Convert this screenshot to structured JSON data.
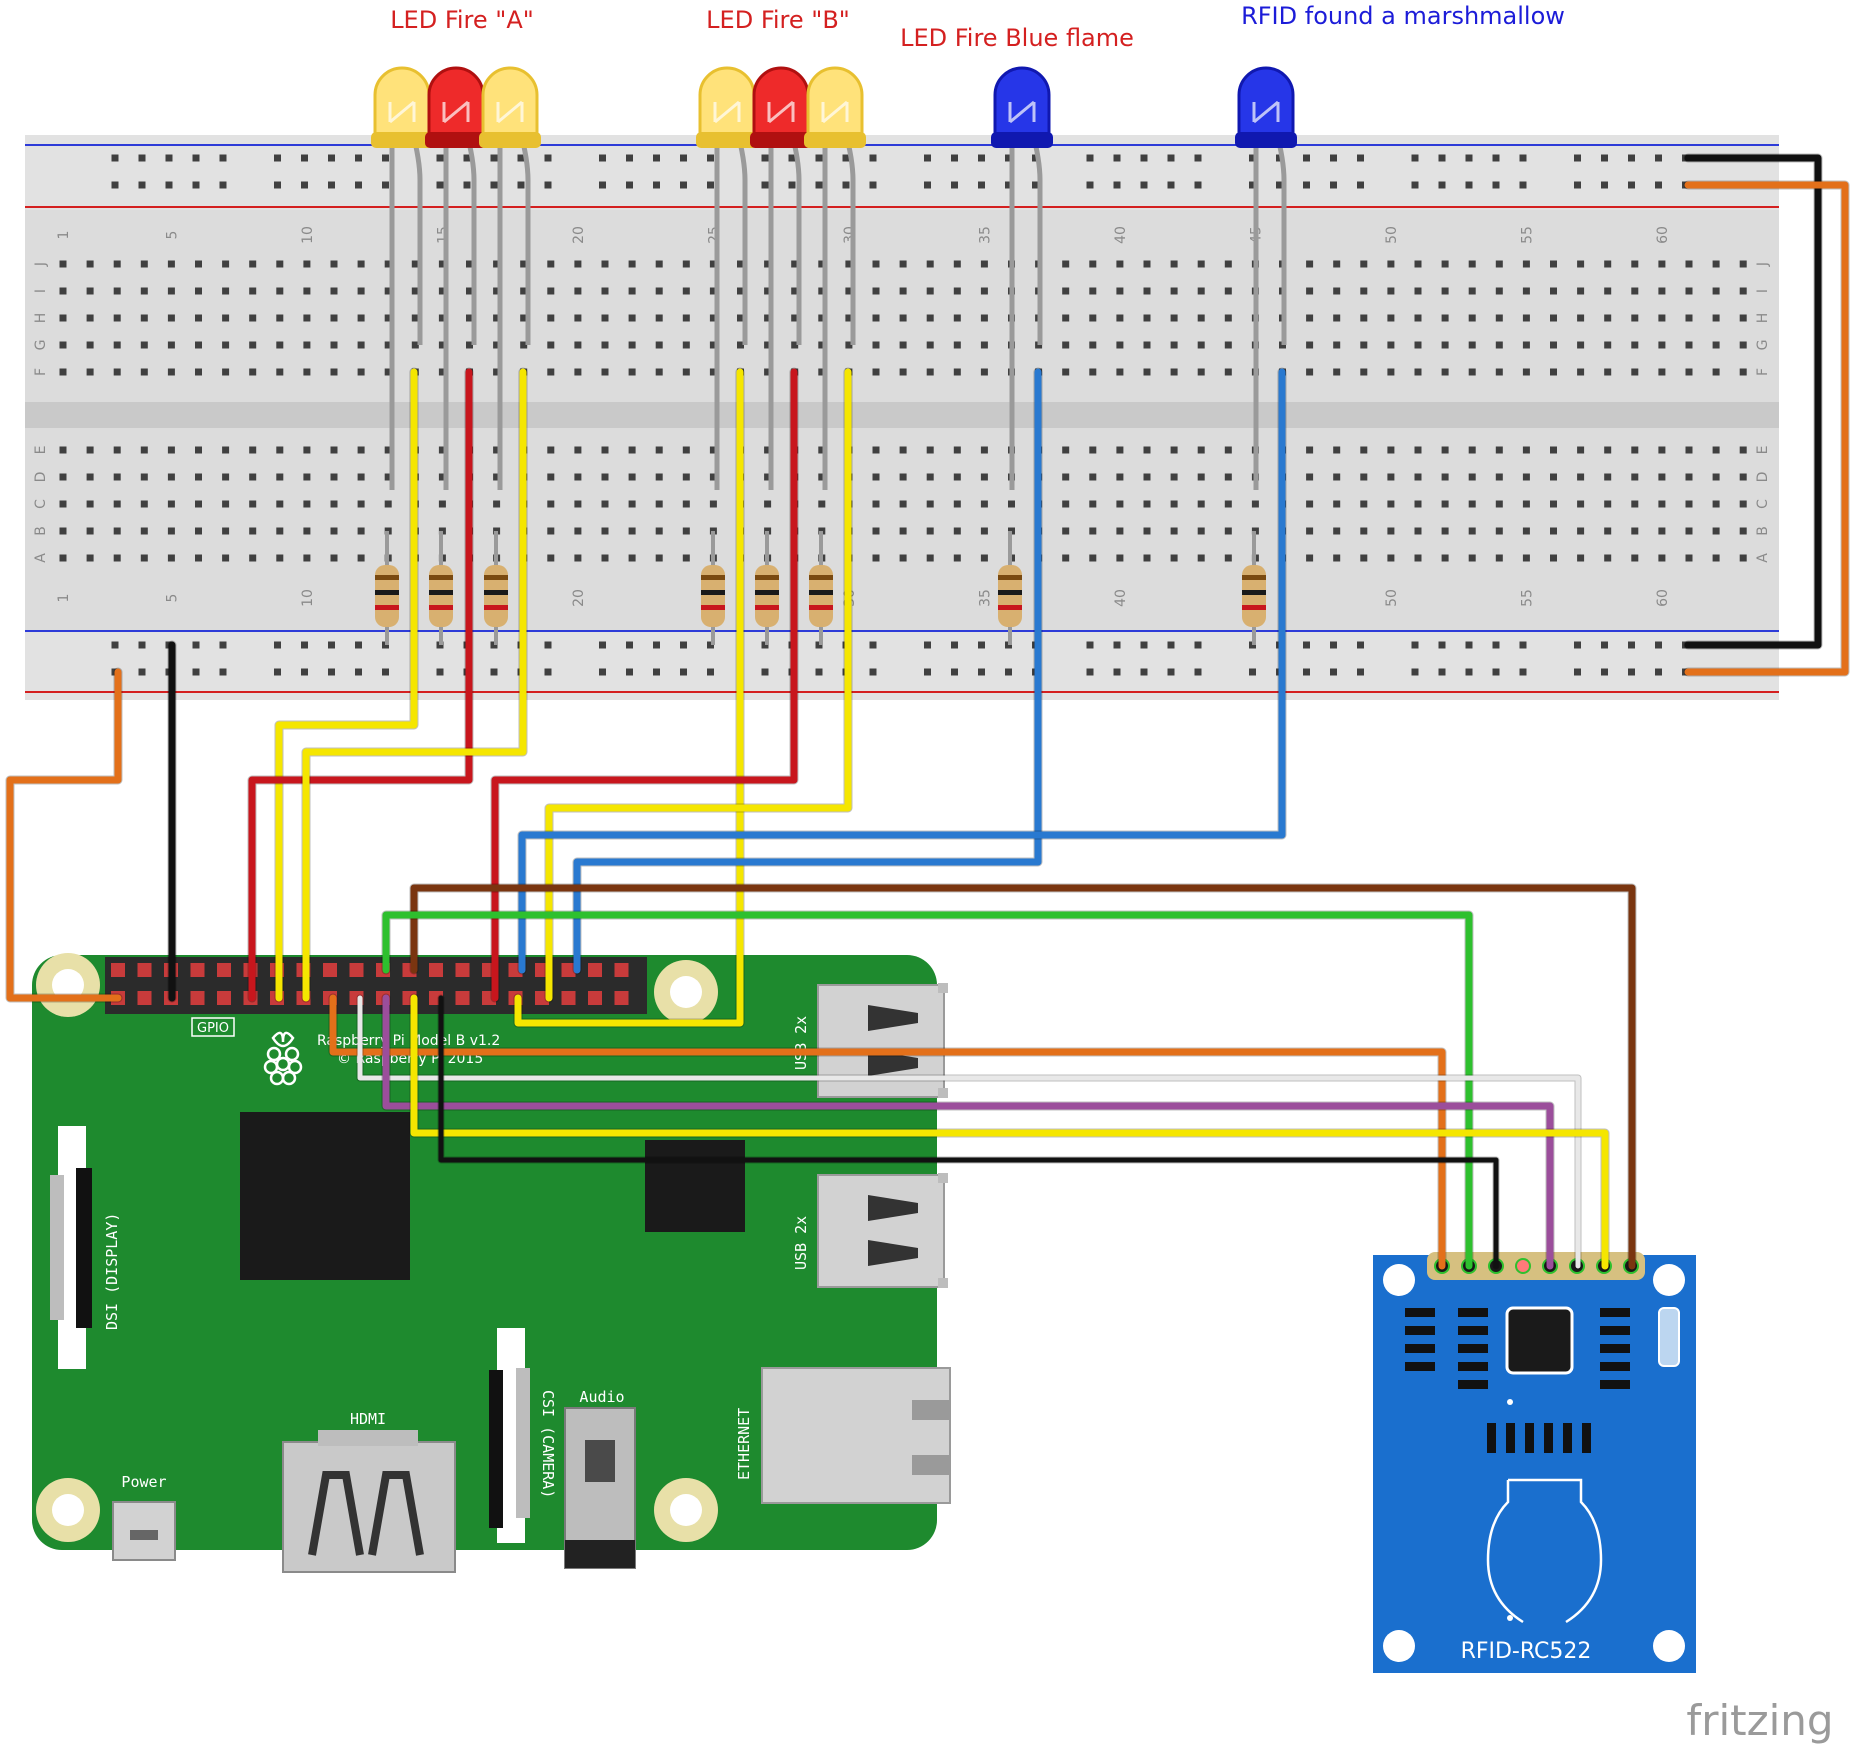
{
  "labels": {
    "led_fire_a": "LED Fire \"A\"",
    "led_fire_b": "LED Fire \"B\"",
    "led_fire_blue": "LED Fire Blue flame",
    "rfid_found": "RFID found a marshmallow"
  },
  "breadboard": {
    "column_numbers": [
      "1",
      "5",
      "10",
      "15",
      "20",
      "25",
      "30",
      "35",
      "40",
      "45",
      "50",
      "55",
      "60"
    ],
    "row_letters_top": [
      "J",
      "I",
      "H",
      "G",
      "F"
    ],
    "row_letters_bottom": [
      "E",
      "D",
      "C",
      "B",
      "A"
    ]
  },
  "raspberry_pi": {
    "gpio_label": "GPIO",
    "model_text": "Raspberry Pi Model B v1.2",
    "copyright_text": "© Raspberry Pi 2015",
    "usb_label_1": "USB 2x",
    "usb_label_2": "USB 2x",
    "dsi_label": "DSI (DISPLAY)",
    "csi_label": "CSI (CAMERA)",
    "hdmi_label": "HDMI",
    "audio_label": "Audio",
    "power_label": "Power",
    "ethernet_label": "ETHERNET"
  },
  "rfid": {
    "label": "RFID-RC522"
  },
  "watermark": {
    "text": "fritzing"
  },
  "colors": {
    "red_label": "#d42020",
    "blue_label": "#1c1cd8",
    "board_green": "#1e8a2e",
    "rfid_blue": "#1a6fce",
    "wire_yellow": "#f5e600",
    "wire_red": "#c8161d",
    "wire_blue": "#2979d0",
    "wire_green": "#2ec02e",
    "wire_brown": "#7a3510",
    "wire_orange": "#e3701a",
    "wire_purple": "#9b4e9b",
    "wire_white": "#e8e8e8",
    "wire_black": "#111111",
    "wire_gray": "#9a9a9a"
  }
}
